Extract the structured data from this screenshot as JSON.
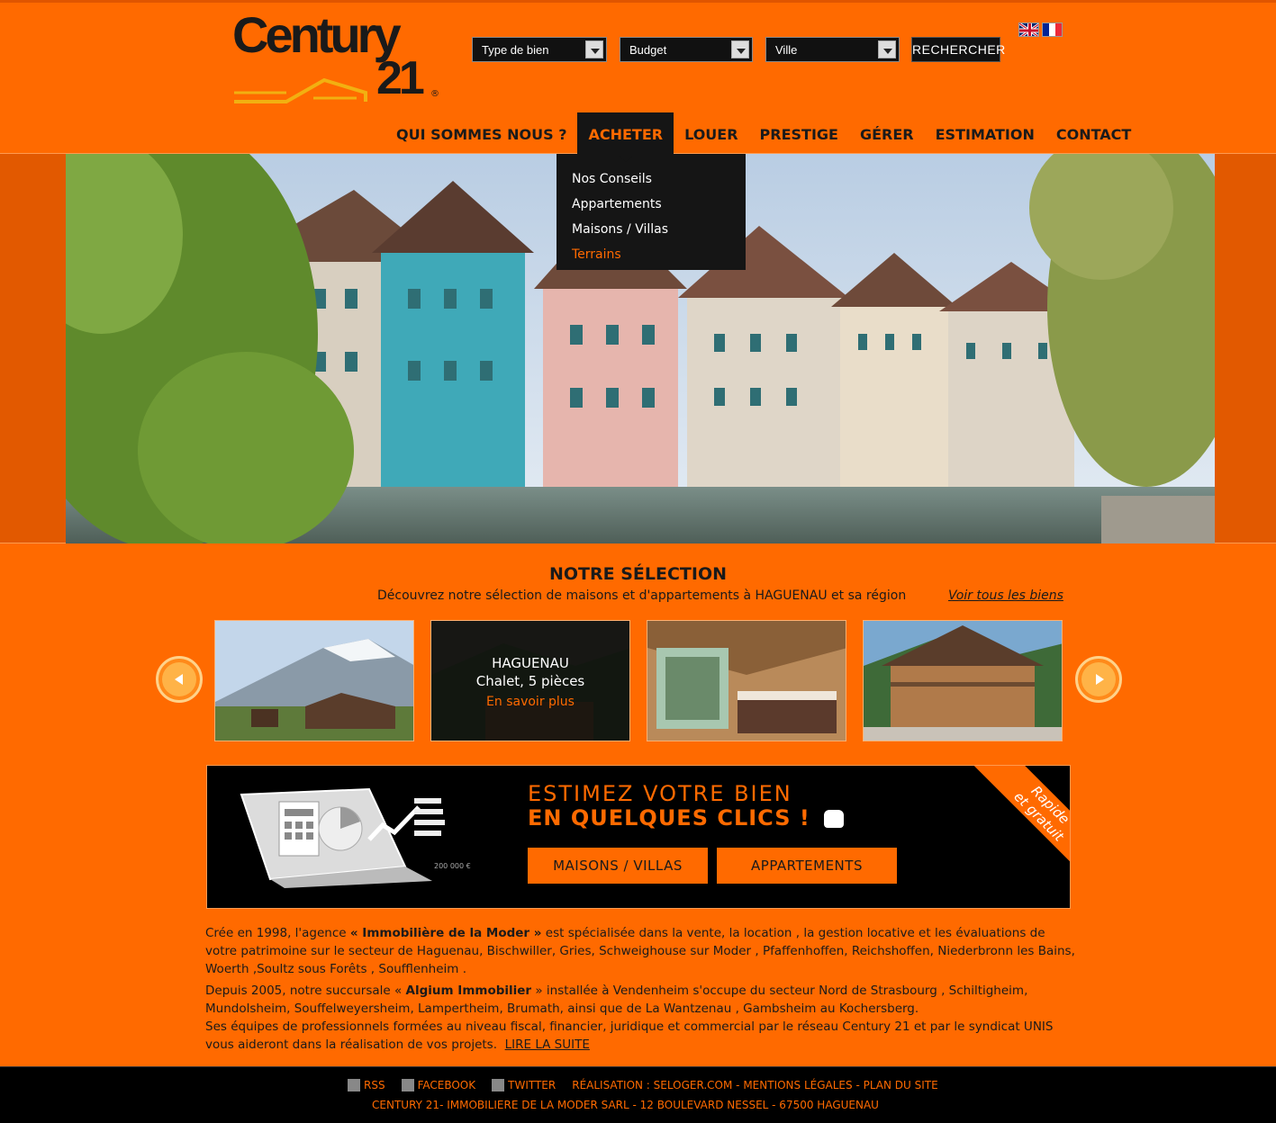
{
  "header": {
    "logo_text": "Century",
    "logo_number": "21",
    "search": {
      "property_type": "Type de bien",
      "budget": "Budget",
      "city": "Ville",
      "button": "RECHERCHER"
    },
    "languages": [
      "english-flag",
      "french-flag"
    ]
  },
  "nav": {
    "items": [
      {
        "label": "QUI SOMMES NOUS ?"
      },
      {
        "label": "ACHETER"
      },
      {
        "label": "LOUER"
      },
      {
        "label": "PRESTIGE"
      },
      {
        "label": "GÉRER"
      },
      {
        "label": "ESTIMATION"
      },
      {
        "label": "CONTACT"
      }
    ],
    "active": "ACHETER",
    "dropdown": [
      {
        "label": "Nos Conseils"
      },
      {
        "label": "Appartements"
      },
      {
        "label": "Maisons / Villas"
      },
      {
        "label": "Terrains"
      }
    ]
  },
  "selection": {
    "title": "NOTRE SÉLECTION",
    "subtitle": "Découvrez notre sélection de maisons et d'appartements à HAGUENAU et sa région",
    "view_all": "Voir tous les biens",
    "featured": {
      "city": "HAGUENAU",
      "type": "Chalet, 5 pièces",
      "link": "En savoir plus"
    }
  },
  "estimate": {
    "line1": "ESTIMEZ VOTRE BIEN",
    "line2": "EN QUELQUES CLICS !",
    "ribbon_line1": "Rapide",
    "ribbon_line2": "et gratuit",
    "laptop_amount": "200 000 €",
    "btn_houses": "MAISONS / VILLAS",
    "btn_apartments": "APPARTEMENTS"
  },
  "about": {
    "p1_start": "Crée en 1998, l'agence ",
    "p1_bold": "« Immobilière de la Moder »",
    "p1_end": " est spécialisée dans la vente, la location , la gestion locative et les évaluations de votre patrimoine sur le secteur de Haguenau, Bischwiller, Gries, Schweighouse sur Moder , Pfaffenhoffen, Reichshoffen, Niederbronn les Bains, Woerth ,Soultz sous Forêts , Soufflenheim .",
    "p2_start": "Depuis 2005, notre succursale « ",
    "p2_bold": "Algium Immobilier",
    "p2_end": " » installée à Vendenheim s'occupe du secteur Nord de Strasbourg , Schiltigheim, Mundolsheim, Souffelweyersheim, Lampertheim, Brumath, ainsi que de La Wantzenau , Gambsheim au Kochersberg.",
    "p3": "Ses équipes de professionnels formées au niveau fiscal, financier, juridique et commercial par le réseau Century 21 et par le syndicat UNIS vous aideront dans la réalisation de vos projets.",
    "read_more": "LIRE LA SUITE"
  },
  "footer": {
    "rss": "RSS",
    "facebook": "FACEBOOK",
    "twitter": "TWITTER",
    "realisation": "RÉALISATION : SELOGER.COM",
    "legal": "MENTIONS LÉGALES",
    "sitemap": "PLAN DU SITE",
    "address": "CENTURY 21- IMMOBILIERE DE LA MODER SARL - 12 BOULEVARD NESSEL - 67500 HAGUENAU"
  },
  "colors": {
    "brand_orange": "#ff6a00",
    "dark": "#151515"
  }
}
